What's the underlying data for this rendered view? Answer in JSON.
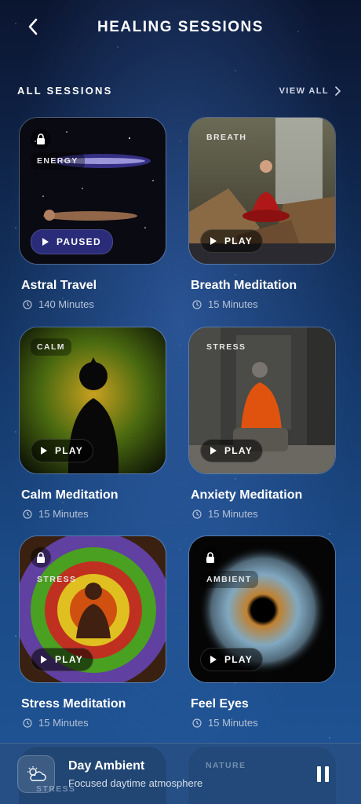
{
  "header": {
    "title": "HEALING SESSIONS"
  },
  "section": {
    "title": "ALL SESSIONS",
    "view_all": "VIEW ALL"
  },
  "sessions": [
    {
      "title": "Astral Travel",
      "duration": "140 Minutes",
      "tag": "ENERGY",
      "button": "PAUSED",
      "locked": true
    },
    {
      "title": "Breath Meditation",
      "duration": "15 Minutes",
      "tag": "BREATH",
      "button": "PLAY",
      "locked": false
    },
    {
      "title": "Calm Meditation",
      "duration": "15 Minutes",
      "tag": "CALM",
      "button": "PLAY",
      "locked": false
    },
    {
      "title": "Anxiety Meditation",
      "duration": "15 Minutes",
      "tag": "STRESS",
      "button": "PLAY",
      "locked": false
    },
    {
      "title": "Stress Meditation",
      "duration": "15 Minutes",
      "tag": "STRESS",
      "button": "PLAY",
      "locked": true
    },
    {
      "title": "Feel Eyes",
      "duration": "15 Minutes",
      "tag": "AMBIENT",
      "button": "PLAY",
      "locked": true
    }
  ],
  "player": {
    "title": "Day Ambient",
    "subtitle": "Focused daytime atmosphere",
    "ghost_tags": [
      "STRESS",
      "NATURE"
    ],
    "icon": "cloud-sun-icon"
  }
}
